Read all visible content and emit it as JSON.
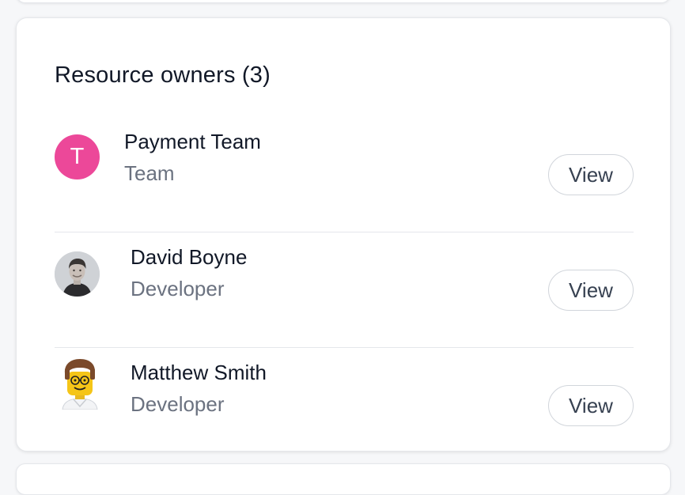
{
  "section": {
    "title": "Resource owners (3)"
  },
  "owners": [
    {
      "avatar_type": "initial",
      "avatar_initial": "T",
      "avatar_color": "#ec4899",
      "name": "Payment Team",
      "role": "Team",
      "action_label": "View"
    },
    {
      "avatar_type": "photo",
      "avatar_icon": "user-photo-icon",
      "name": "David Boyne",
      "role": "Developer",
      "action_label": "View"
    },
    {
      "avatar_type": "illustration",
      "avatar_icon": "lego-figure-icon",
      "name": "Matthew Smith",
      "role": "Developer",
      "action_label": "View"
    }
  ],
  "colors": {
    "primary_text": "#111827",
    "secondary_text": "#6b7280",
    "border": "#e5e7eb"
  }
}
